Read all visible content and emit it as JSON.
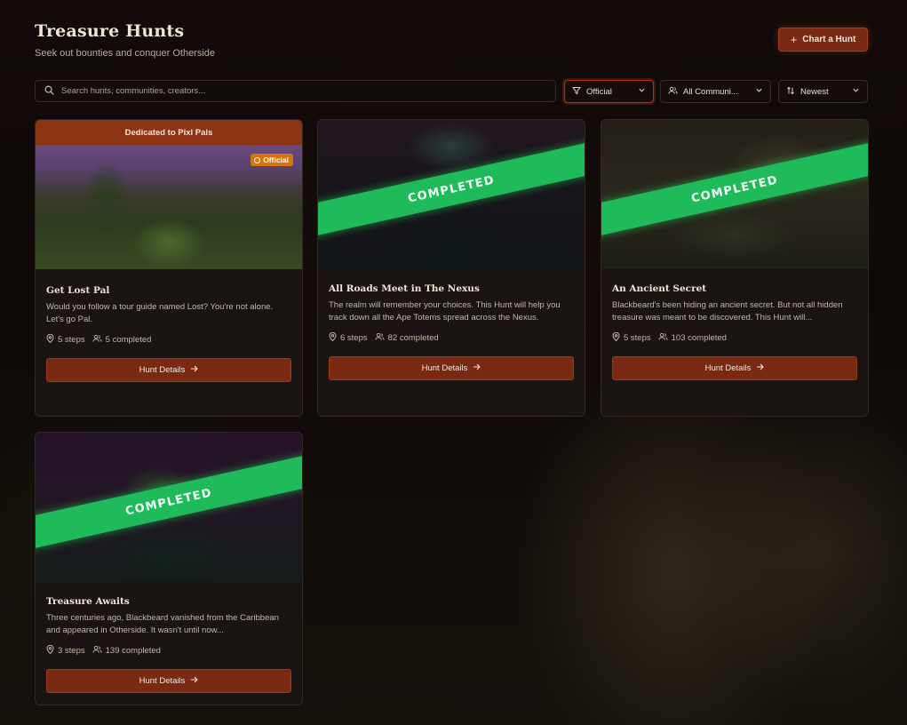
{
  "header": {
    "title": "Treasure Hunts",
    "subtitle": "Seek out bounties and conquer Otherside",
    "chart_button": "Chart a Hunt"
  },
  "filters": {
    "search_placeholder": "Search hunts, communities, creators...",
    "official": "Official",
    "communities": "All Communi...",
    "sort": "Newest"
  },
  "cards": [
    {
      "banner": "Dedicated to Pixl Pals",
      "badge": "Official",
      "title": "Get Lost Pal",
      "description": "Would you follow a tour guide named Lost? You're not alone. Let's go Pal.",
      "steps": "5 steps",
      "completed": "5 completed",
      "button": "Hunt Details"
    },
    {
      "ribbon": "COMPLETED",
      "title": "All Roads Meet in The Nexus",
      "description": "The realm will remember your choices. This Hunt will help you track down all the Ape Totems spread across the Nexus.",
      "steps": "6 steps",
      "completed": "82 completed",
      "button": "Hunt Details"
    },
    {
      "ribbon": "COMPLETED",
      "title": "An Ancient Secret",
      "description": "Blackbeard's been hiding an ancient secret. But not all hidden treasure was meant to be discovered. This Hunt will...",
      "steps": "5 steps",
      "completed": "103 completed",
      "button": "Hunt Details"
    },
    {
      "ribbon": "COMPLETED",
      "title": "Treasure Awaits",
      "description": "Three centuries ago, Blackbeard vanished from the Caribbean and appeared in Otherside. It wasn't until now...",
      "steps": "3 steps",
      "completed": "139 completed",
      "button": "Hunt Details"
    }
  ]
}
